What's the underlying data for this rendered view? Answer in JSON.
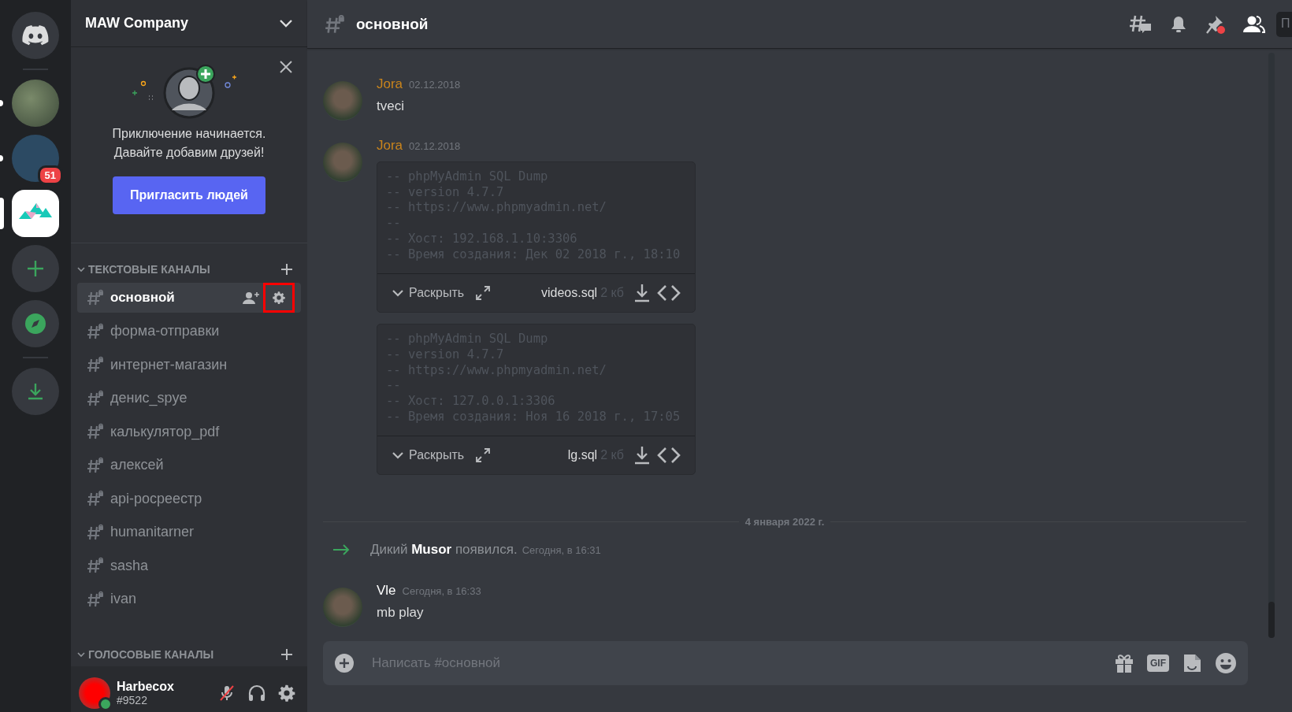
{
  "servers": [
    {
      "kind": "home",
      "selected": false,
      "unread": false
    },
    {
      "kind": "separator"
    },
    {
      "kind": "photo",
      "selected": false,
      "unread": true
    },
    {
      "kind": "photo",
      "selected": false,
      "unread": true,
      "badge": "51"
    },
    {
      "kind": "logo",
      "selected": true,
      "unread": false
    },
    {
      "kind": "add"
    },
    {
      "kind": "explore"
    },
    {
      "kind": "separator"
    },
    {
      "kind": "download"
    }
  ],
  "sidebar": {
    "title": "MAW Company",
    "invite_card": {
      "lines": [
        "Приключение начинается.",
        "Давайте добавим друзей!"
      ],
      "button": "Пригласить людей"
    },
    "categories": [
      {
        "name": "ТЕКСТОВЫЕ КАНАЛЫ",
        "expanded": true,
        "channels": [
          {
            "name": "основной",
            "selected": true,
            "settings_marked": true
          },
          {
            "name": "форма-отправки",
            "selected": false,
            "settings_marked": false
          },
          {
            "name": "интернет-магазин",
            "selected": false,
            "settings_marked": false
          },
          {
            "name": "денис_spye",
            "selected": false,
            "settings_marked": false
          },
          {
            "name": "калькулятор_pdf",
            "selected": false,
            "settings_marked": false
          },
          {
            "name": "алексей",
            "selected": false,
            "settings_marked": false
          },
          {
            "name": "api-росреестр",
            "selected": false,
            "settings_marked": false
          },
          {
            "name": "humanitarner",
            "selected": false,
            "settings_marked": false
          },
          {
            "name": "sasha",
            "selected": false,
            "settings_marked": false
          },
          {
            "name": "ivan",
            "selected": false,
            "settings_marked": false
          }
        ]
      },
      {
        "name": "ГОЛОСОВЫЕ КАНАЛЫ",
        "expanded": true
      }
    ]
  },
  "user_panel": {
    "name": "Harbecox",
    "tag": "#9522",
    "online": true,
    "muted": true
  },
  "header": {
    "channel": "основной",
    "search_placeholder": "П"
  },
  "messages": [
    {
      "kind": "message",
      "author": "Jora",
      "color": "#c9841c",
      "time": "02.12.2018",
      "text": "tveci"
    },
    {
      "kind": "message",
      "author": "Jora",
      "color": "#c9841c",
      "time": "02.12.2018",
      "attachments": [
        {
          "lines": [
            "-- phpMyAdmin SQL Dump",
            "-- version 4.7.7",
            "-- https://www.phpmyadmin.net/",
            "--",
            "-- Хост: 192.168.1.10:3306",
            "-- Время создания: Дек 02 2018 г., 18:10"
          ],
          "expand": "Раскрыть",
          "filename": "videos.sql",
          "size": "2 кб"
        },
        {
          "lines": [
            "-- phpMyAdmin SQL Dump",
            "-- version 4.7.7",
            "-- https://www.phpmyadmin.net/",
            "--",
            "-- Хост: 127.0.0.1:3306",
            "-- Время создания: Ноя 16 2018 г., 17:05"
          ],
          "expand": "Раскрыть",
          "filename": "lg.sql",
          "size": "2 кб"
        }
      ]
    },
    {
      "kind": "divider",
      "text": "4 января 2022 г."
    },
    {
      "kind": "join",
      "text": "Дикий **Musor** появился.",
      "time": "Сегодня, в 16:31"
    },
    {
      "kind": "message",
      "author": "Vle",
      "color": "#ffffff",
      "time": "Сегодня, в 16:33",
      "text": "mb play"
    }
  ],
  "composer": {
    "placeholder": "Написать #основной",
    "gif_label": "GIF"
  }
}
